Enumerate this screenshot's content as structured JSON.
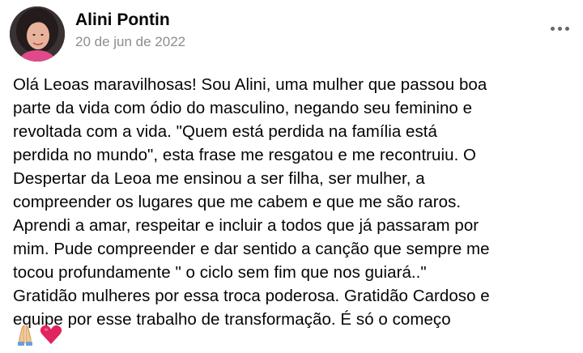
{
  "post": {
    "author": "Alini Pontin",
    "date": "20 de jun de 2022",
    "more_icon": "ellipsis-icon",
    "body_lines": [
      "Olá Leoas maravilhosas! Sou Alini, uma mulher que passou boa",
      "parte da vida com ódio do masculino, negando seu feminino e",
      "revoltada com a vida. \"Quem está perdida na família está",
      "perdida no mundo\", esta frase me resgatou e me recontruiu. O",
      "Despertar da Leoa me ensinou a ser filha, ser mulher, a",
      "compreender os lugares que me cabem e que me são raros.",
      "Aprendi a amar, respeitar e incluir a todos que já passaram por",
      "mim. Pude compreender e dar sentido a canção que sempre me",
      "tocou profundamente \" o ciclo sem fim que nos guiará..\"",
      "Gratidão mulheres por essa troca poderosa. Gratidão Cardoso e",
      "equipe por esse trabalho de transformação. É só o começo"
    ],
    "emojis": [
      "praying-hands-emoji",
      "red-heart-emoji"
    ]
  },
  "colors": {
    "text": "#050505",
    "secondary_text": "#8a8d91",
    "heart": "#e0245e",
    "background": "#ffffff"
  }
}
